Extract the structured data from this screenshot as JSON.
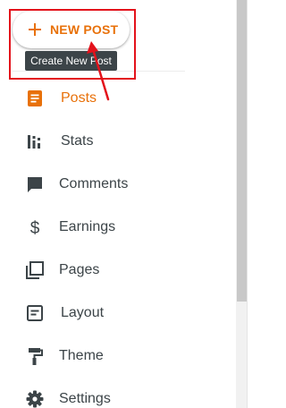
{
  "colors": {
    "accent": "#e8710a",
    "icon": "#3c4448",
    "text": "#3c4448",
    "annotation_red": "#e3121b",
    "tooltip_bg": "#3c4448"
  },
  "new_post": {
    "label": "NEW POST",
    "icon": "plus-icon",
    "tooltip": "Create New Post"
  },
  "nav": [
    {
      "label": "Posts",
      "icon": "posts-icon",
      "active": true
    },
    {
      "label": "Stats",
      "icon": "stats-icon",
      "active": false
    },
    {
      "label": "Comments",
      "icon": "comments-icon",
      "active": false
    },
    {
      "label": "Earnings",
      "icon": "dollar-icon",
      "active": false
    },
    {
      "label": "Pages",
      "icon": "pages-icon",
      "active": false
    },
    {
      "label": "Layout",
      "icon": "layout-icon",
      "active": false
    },
    {
      "label": "Theme",
      "icon": "paint-roller-icon",
      "active": false
    },
    {
      "label": "Settings",
      "icon": "gear-icon",
      "active": false
    }
  ]
}
